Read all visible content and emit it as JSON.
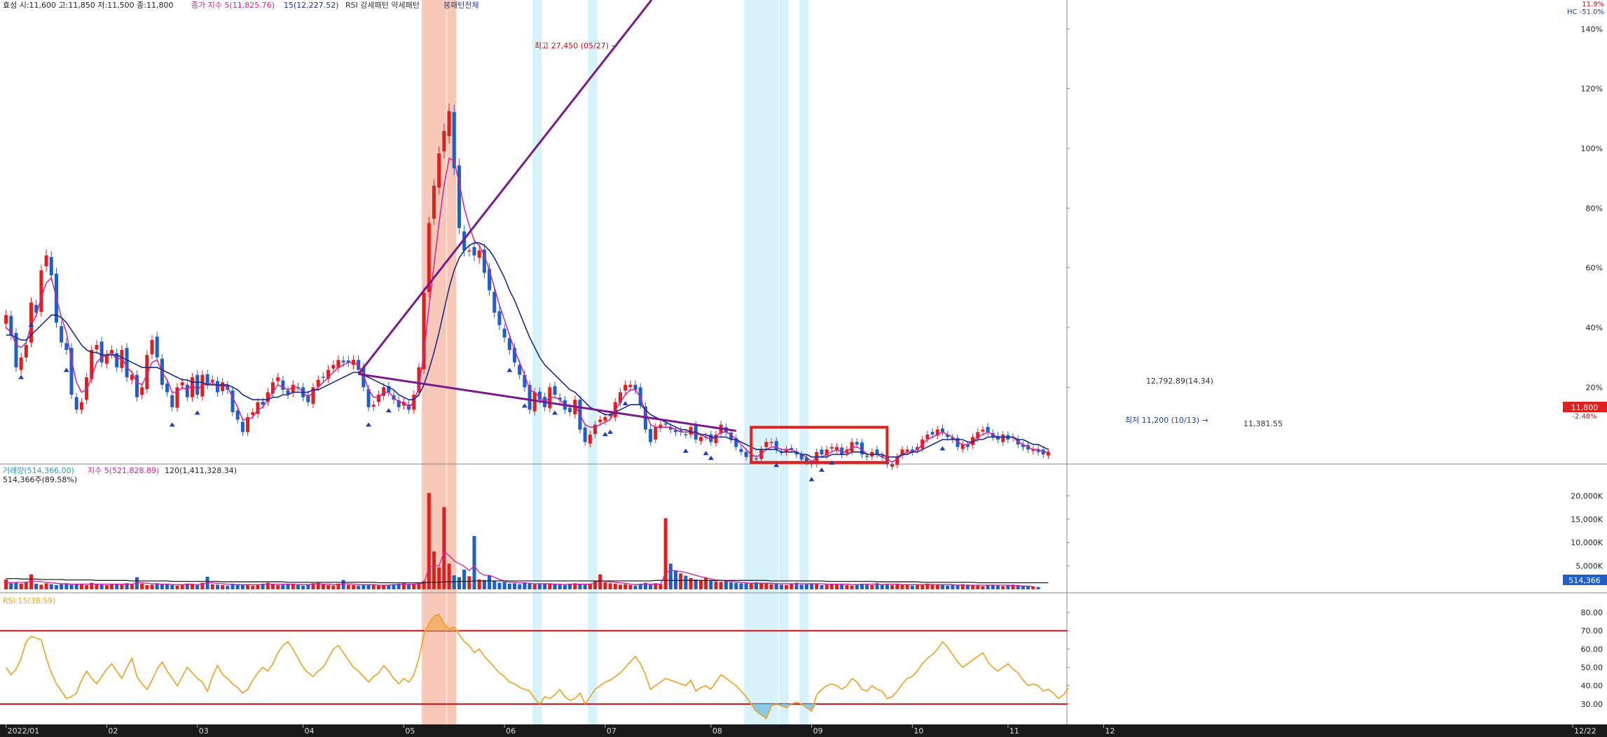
{
  "price_header": {
    "summary": "효성 시:11,600 고:11,850 저:11,500 종:11,800",
    "ma5": "종가 지수 5(11,825.76)",
    "ma15": "15(12,227.52)",
    "rsi_label": "RSI 강세패턴  약세패턴",
    "pattern": "봉패턴전체",
    "corner_top": "11.9%",
    "corner_bottom": "HC -51.0%"
  },
  "annotations": {
    "high": "최고 27,450 (05/27) →",
    "low": "최저 11,200 (10/13) →",
    "box_top": "12,792.89(14.34)",
    "box_bottom": "11,381.55",
    "last_price": "11,800",
    "last_change": "-2.48%"
  },
  "volume_header": {
    "volume": "거래량(514,366.00)",
    "ma5": "지수 5(521,828.89)",
    "ma120": "120(1,411,328.34)",
    "sub": "514,366주(89.58%)",
    "last": "514,366"
  },
  "rsi_header": {
    "label": "RSI 15(38.59)"
  },
  "x_axis": {
    "labels": [
      "2022/01",
      "02",
      "03",
      "04",
      "05",
      "06",
      "07",
      "08",
      "09",
      "10",
      "11",
      "12",
      "12/22"
    ]
  },
  "price_axis": {
    "labels": [
      "140%",
      "120%",
      "100%",
      "80%",
      "60%",
      "40%",
      "20%"
    ]
  },
  "volume_axis": {
    "labels": [
      "20,000K",
      "15,000K",
      "10,000K",
      "5,000K"
    ]
  },
  "rsi_axis": {
    "labels": [
      "80.00",
      "70.00",
      "60.00",
      "50.00",
      "40.00",
      "30.00"
    ]
  },
  "colors": {
    "up": "#e0201e",
    "down": "#1f5fc8",
    "ma5": "#d0209a",
    "ma15": "#1a2a8a",
    "trend": "#7a1a8a",
    "rsi": "#f0a020",
    "rsi_bound": "#d01010",
    "highlight_red": "#f7c8b8",
    "highlight_blue": "#d8f2fb"
  },
  "chart_data": {
    "type": "candlestick",
    "x_range": [
      "2022/01",
      "12/22"
    ],
    "price_close": [
      17300,
      16500,
      15200,
      15600,
      16100,
      17800,
      17400,
      19100,
      19700,
      18900,
      17000,
      16200,
      15900,
      14100,
      13500,
      13800,
      14800,
      15900,
      16100,
      15400,
      15700,
      15900,
      15200,
      15900,
      14800,
      14900,
      14000,
      14400,
      15700,
      16300,
      15600,
      14500,
      14200,
      13600,
      14400,
      14600,
      14000,
      14800,
      14100,
      14900,
      14500,
      14700,
      14200,
      14600,
      14300,
      13400,
      13100,
      12600,
      13200,
      13400,
      13800,
      13700,
      14200,
      14600,
      14800,
      14300,
      14100,
      14500,
      14400,
      14000,
      13800,
      14400,
      14700,
      14800,
      15100,
      15300,
      15500,
      15400,
      15400,
      15500,
      15100,
      14400,
      13600,
      13700,
      14100,
      14400,
      14200,
      13900,
      13600,
      13800,
      13500,
      14100,
      15200,
      18200,
      21000,
      22500,
      23800,
      24700,
      25500,
      23200,
      20800,
      19900,
      19900,
      19700,
      19900,
      19000,
      18300,
      17400,
      16900,
      16400,
      15900,
      15400,
      14900,
      14400,
      13500,
      14200,
      13900,
      13600,
      14400,
      14100,
      13900,
      13500,
      13400,
      13900,
      12700,
      12200,
      12500,
      12900,
      13100,
      13200,
      13300,
      13800,
      14200,
      14500,
      14500,
      14300,
      13700,
      12700,
      12200,
      12800,
      12900,
      12900,
      12700,
      12600,
      12600,
      12500,
      12800,
      12300,
      12400,
      12400,
      12200,
      12500,
      12900,
      12600,
      12300,
      12000,
      11800,
      11600,
      11600,
      11500,
      11900,
      12200,
      12200,
      11900,
      11800,
      11900,
      11900,
      11700,
      11500,
      11400,
      11300,
      11800,
      11700,
      11900,
      12000,
      12000,
      11700,
      11900,
      12200,
      12100,
      11700,
      11600,
      11800,
      11700,
      11600,
      11300,
      11300,
      11600,
      11900,
      11900,
      11800,
      12000,
      12300,
      12500,
      12500,
      12700,
      12600,
      12400,
      12300,
      12000,
      12100,
      12000,
      12400,
      12600,
      12700,
      12600,
      12400,
      12300,
      12500,
      12300,
      12400,
      12100,
      12000,
      11900,
      11900,
      11800,
      11700,
      11800
    ],
    "ma5": [
      16800,
      16600,
      16100,
      16000,
      16200,
      16900,
      17300,
      18000,
      18600,
      18800,
      18000,
      17200,
      16600,
      15500,
      14600,
      14200,
      14300,
      14800,
      15400,
      15600,
      15700,
      15800,
      15500,
      15600,
      15200,
      15000,
      14600,
      14500,
      14900,
      15400,
      15500,
      15000,
      14700,
      14200,
      14200,
      14400,
      14300,
      14500,
      14300,
      14500,
      14500,
      14600,
      14400,
      14500,
      14400,
      14000,
      13600,
      13100,
      13100,
      13200,
      13500,
      13600,
      13900,
      14200,
      14500,
      14400,
      14300,
      14400,
      14400,
      14200,
      14000,
      14200,
      14400,
      14600,
      14800,
      15000,
      15200,
      15300,
      15400,
      15400,
      15300,
      14900,
      14300,
      14000,
      14000,
      14200,
      14200,
      14000,
      13800,
      13800,
      13600,
      13800,
      14400,
      15800,
      17600,
      19300,
      21000,
      22500,
      23600,
      23500,
      22600,
      21600,
      20900,
      20300,
      20100,
      19700,
      19100,
      18400,
      17700,
      17100,
      16500,
      15900,
      15400,
      14900,
      14300,
      14200,
      14000,
      13800,
      14000,
      14000,
      13900,
      13700,
      13600,
      13700,
      13300,
      12900,
      12800,
      12800,
      12900,
      13000,
      13100,
      13500,
      13800,
      14100,
      14300,
      14300,
      14000,
      13400,
      12900,
      12800,
      12800,
      12800,
      12800,
      12700,
      12600,
      12600,
      12600,
      12500,
      12500,
      12400,
      12300,
      12400,
      12600,
      12600,
      12500,
      12300,
      12100,
      11900,
      11700,
      11600,
      11700,
      11900,
      12000,
      12000,
      11900,
      11900,
      11900,
      11800,
      11700,
      11600,
      11400,
      11600,
      11600,
      11700,
      11800,
      11900,
      11800,
      11800,
      12000,
      12000,
      11900,
      11700,
      11700,
      11700,
      11600,
      11500,
      11400,
      11500,
      11700,
      11800,
      11800,
      11900,
      12100,
      12300,
      12400,
      12500,
      12600,
      12500,
      12400,
      12200,
      12100,
      12100,
      12200,
      12400,
      12500,
      12600,
      12500,
      12400,
      12400,
      12400,
      12400,
      12200,
      12100,
      12000,
      11900,
      11900,
      11800,
      11800
    ],
    "ma15": [
      16500,
      16500,
      16400,
      16300,
      16300,
      16500,
      16700,
      16900,
      17100,
      17300,
      17300,
      17200,
      17000,
      16700,
      16400,
      16100,
      15900,
      15800,
      15800,
      15700,
      15700,
      15700,
      15700,
      15600,
      15500,
      15400,
      15300,
      15200,
      15200,
      15200,
      15200,
      15100,
      15000,
      14900,
      14800,
      14700,
      14700,
      14600,
      14600,
      14600,
      14500,
      14500,
      14500,
      14500,
      14500,
      14400,
      14300,
      14100,
      14000,
      13900,
      13900,
      13900,
      13900,
      14000,
      14000,
      14100,
      14100,
      14200,
      14200,
      14200,
      14200,
      14300,
      14300,
      14400,
      14500,
      14600,
      14700,
      14800,
      14900,
      15000,
      15000,
      14900,
      14800,
      14700,
      14600,
      14500,
      14400,
      14300,
      14100,
      14000,
      13900,
      13900,
      14100,
      14500,
      15100,
      15800,
      16600,
      17500,
      18400,
      19100,
      19600,
      19900,
      20100,
      20200,
      20200,
      20100,
      19900,
      19600,
      19200,
      18800,
      18300,
      17900,
      17400,
      16900,
      16400,
      16000,
      15600,
      15300,
      15100,
      14900,
      14700,
      14500,
      14300,
      14200,
      14000,
      13800,
      13600,
      13500,
      13400,
      13300,
      13300,
      13400,
      13500,
      13600,
      13700,
      13700,
      13700,
      13500,
      13300,
      13200,
      13100,
      13000,
      12900,
      12800,
      12700,
      12700,
      12600,
      12600,
      12500,
      12500,
      12400,
      12400,
      12400,
      12400,
      12300,
      12300,
      12200,
      12100,
      12000,
      11900,
      11900,
      11900,
      11900,
      11900,
      11800,
      11800,
      11800,
      11800,
      11700,
      11700,
      11600,
      11600,
      11600,
      11600,
      11700,
      11700,
      11700,
      11700,
      11800,
      11800,
      11800,
      11700,
      11700,
      11700,
      11700,
      11600,
      11600,
      11600,
      11700,
      11700,
      11800,
      11800,
      11900,
      12000,
      12100,
      12200,
      12300,
      12300,
      12300,
      12300,
      12300,
      12200,
      12200,
      12300,
      12300,
      12400,
      12400,
      12400,
      12400,
      12400,
      12400,
      12300,
      12300,
      12200,
      12100,
      12100,
      12000,
      11900
    ],
    "volume_k": [
      2100,
      1300,
      1400,
      1200,
      1600,
      3200,
      1200,
      1000,
      1300,
      1100,
      900,
      1200,
      1300,
      1000,
      1100,
      1200,
      900,
      1400,
      1200,
      1000,
      900,
      1100,
      1200,
      1000,
      1300,
      1100,
      2600,
      1200,
      900,
      1000,
      1300,
      1100,
      1200,
      900,
      800,
      1000,
      1200,
      1100,
      900,
      1400,
      2700,
      1100,
      1000,
      900,
      800,
      1200,
      1100,
      1000,
      900,
      800,
      1000,
      1200,
      1400,
      1100,
      900,
      1000,
      1100,
      1200,
      900,
      800,
      1000,
      1300,
      1400,
      1100,
      900,
      800,
      1200,
      2000,
      1000,
      900,
      800,
      1000,
      900,
      1100,
      800,
      900,
      1000,
      1100,
      1200,
      1300,
      1000,
      1200,
      1300,
      1800,
      20600,
      8100,
      4700,
      17600,
      5500,
      3000,
      2600,
      4200,
      2800,
      11400,
      2100,
      2000,
      3000,
      1800,
      1400,
      1600,
      1200,
      1300,
      1100,
      1400,
      1200,
      1100,
      1300,
      1300,
      1200,
      1100,
      1000,
      900,
      1200,
      1300,
      1100,
      1000,
      1200,
      1800,
      3200,
      1500,
      1300,
      1200,
      1000,
      1100,
      900,
      800,
      1200,
      1400,
      1000,
      1300,
      1100,
      15200,
      5500,
      4000,
      3400,
      2900,
      2400,
      2100,
      2000,
      2500,
      1800,
      1700,
      1600,
      1800,
      1500,
      1400,
      1300,
      1300,
      1200,
      1500,
      1400,
      1200,
      1100,
      1300,
      1000,
      900,
      1200,
      1400,
      1000,
      1100,
      1300,
      1200,
      900,
      1000,
      1200,
      1100,
      1000,
      900,
      800,
      1100,
      1200,
      1000,
      900,
      1300,
      1100,
      1000,
      900,
      1200,
      1000,
      1100,
      800,
      900,
      1000,
      1200,
      1100,
      900,
      1000,
      800,
      900,
      1000,
      1100,
      1000,
      900,
      800,
      700,
      900,
      1000,
      800,
      700,
      900,
      1000,
      900,
      800,
      700,
      600,
      514
    ],
    "volume_ma5_k": [
      1400,
      1400,
      1500,
      1500,
      1500,
      1800,
      1700,
      1600,
      1500,
      1400,
      1300,
      1200,
      1200,
      1100,
      1100,
      1100,
      1100,
      1100,
      1100,
      1100,
      1100,
      1100,
      1100,
      1100,
      1100,
      1100,
      1400,
      1400,
      1300,
      1200,
      1200,
      1100,
      1100,
      1000,
      1000,
      1000,
      1100,
      1100,
      1000,
      1100,
      1400,
      1400,
      1300,
      1200,
      1100,
      1000,
      1000,
      1000,
      1000,
      1000,
      1000,
      1000,
      1100,
      1100,
      1100,
      1100,
      1100,
      1100,
      1000,
      1000,
      1000,
      1100,
      1200,
      1100,
      1100,
      1000,
      1000,
      1200,
      1200,
      1100,
      1000,
      1000,
      1000,
      1000,
      900,
      900,
      900,
      1000,
      1000,
      1100,
      1100,
      1100,
      1200,
      1300,
      4500,
      5200,
      5000,
      8000,
      7200,
      6100,
      5500,
      4900,
      4000,
      5000,
      3600,
      3000,
      3000,
      2600,
      2100,
      1800,
      1500,
      1500,
      1400,
      1400,
      1300,
      1200,
      1200,
      1200,
      1200,
      1100,
      1100,
      1000,
      1100,
      1100,
      1100,
      1100,
      1100,
      1300,
      1800,
      1700,
      1600,
      1500,
      1400,
      1300,
      1100,
      1000,
      1000,
      1100,
      1100,
      1100,
      1100,
      3600,
      4000,
      4000,
      3800,
      3600,
      3300,
      3000,
      2700,
      2500,
      2200,
      2000,
      1900,
      1800,
      1700,
      1600,
      1500,
      1400,
      1300,
      1300,
      1300,
      1300,
      1300,
      1200,
      1200,
      1200,
      1200,
      1200,
      1200,
      1200,
      1200,
      1200,
      1200,
      1100,
      1100,
      1100,
      1100,
      1100,
      1000,
      1000,
      1000,
      1100,
      1100,
      1100,
      1000,
      1100,
      1100,
      1100,
      1000,
      1000,
      1000,
      1000,
      1000,
      1000,
      1000,
      1000,
      1000,
      1000,
      1000,
      900,
      900,
      900,
      900,
      900,
      900,
      900,
      900,
      900,
      900,
      900,
      800,
      800,
      700,
      700,
      600
    ],
    "volume_ma120_k": [
      2300,
      2300,
      2300,
      2200,
      2200,
      2200,
      2200,
      2100,
      2100,
      2100,
      2100,
      2100,
      2000,
      2000,
      2000,
      2000,
      2000,
      2000,
      1900,
      1900,
      1900,
      1900,
      1900,
      1900,
      1900,
      1800,
      1800,
      1800,
      1800,
      1800,
      1800,
      1800,
      1800,
      1700,
      1700,
      1700,
      1700,
      1700,
      1700,
      1700,
      1700,
      1700,
      1700,
      1600,
      1600,
      1600,
      1600,
      1600,
      1600,
      1600,
      1600,
      1600,
      1600,
      1600,
      1600,
      1600,
      1500,
      1500,
      1500,
      1500,
      1500,
      1500,
      1500,
      1500,
      1500,
      1500,
      1500,
      1500,
      1500,
      1500,
      1500,
      1500,
      1500,
      1500,
      1400,
      1400,
      1400,
      1400,
      1400,
      1400,
      1400,
      1400,
      1400,
      1400,
      1500,
      1500,
      1500,
      1600,
      1600,
      1600,
      1700,
      1700,
      1700,
      1800,
      1800,
      1800,
      1800,
      1800,
      1800,
      1800,
      1800,
      1800,
      1800,
      1800,
      1800,
      1800,
      1800,
      1800,
      1800,
      1800,
      1800,
      1800,
      1800,
      1800,
      1800,
      1800,
      1800,
      1800,
      1800,
      1800,
      1800,
      1800,
      1800,
      1800,
      1800,
      1800,
      1800,
      1800,
      1800,
      1900,
      1900,
      1900,
      1900,
      1900,
      1900,
      1900,
      1900,
      1900,
      1900,
      1900,
      1900,
      1900,
      1900,
      1900,
      1900,
      1900,
      1900,
      1900,
      1900,
      1900,
      1900,
      1900,
      1800,
      1800,
      1800,
      1800,
      1800,
      1800,
      1800,
      1800,
      1800,
      1800,
      1800,
      1700,
      1700,
      1700,
      1700,
      1700,
      1700,
      1700,
      1700,
      1700,
      1700,
      1600,
      1600,
      1600,
      1600,
      1600,
      1600,
      1600,
      1600,
      1600,
      1500,
      1500,
      1500,
      1500,
      1500,
      1500,
      1500,
      1500,
      1500,
      1500,
      1500,
      1400,
      1400,
      1400,
      1400,
      1400,
      1400,
      1400,
      1400,
      1400,
      1400,
      1400,
      1400,
      1400,
      1400,
      1400
    ],
    "rsi": [
      50,
      46,
      49,
      55,
      64,
      67,
      66,
      65,
      55,
      47,
      41,
      37,
      33,
      34,
      36,
      43,
      48,
      44,
      41,
      45,
      49,
      52,
      48,
      44,
      50,
      55,
      45,
      41,
      38,
      43,
      49,
      53,
      48,
      44,
      40,
      45,
      50,
      47,
      44,
      42,
      37,
      45,
      51,
      46,
      44,
      41,
      39,
      36,
      38,
      43,
      47,
      50,
      48,
      52,
      58,
      62,
      64,
      60,
      55,
      50,
      47,
      45,
      48,
      50,
      55,
      60,
      62,
      58,
      54,
      50,
      48,
      45,
      42,
      45,
      47,
      51,
      48,
      44,
      41,
      44,
      42,
      46,
      55,
      68,
      74,
      78,
      79,
      74,
      71,
      72,
      68,
      64,
      62,
      58,
      60,
      56,
      53,
      50,
      47,
      45,
      42,
      41,
      39,
      38,
      37,
      33,
      30,
      34,
      33,
      35,
      38,
      34,
      32,
      33,
      36,
      30,
      34,
      38,
      40,
      42,
      43,
      45,
      47,
      50,
      53,
      56,
      52,
      46,
      38,
      40,
      42,
      44,
      43,
      42,
      41,
      40,
      43,
      37,
      39,
      40,
      38,
      42,
      46,
      44,
      42,
      40,
      37,
      34,
      30,
      26,
      24,
      22,
      29,
      30,
      29,
      28,
      30,
      31,
      30,
      28,
      26,
      35,
      38,
      40,
      41,
      40,
      38,
      40,
      44,
      42,
      38,
      37,
      40,
      38,
      37,
      33,
      34,
      37,
      41,
      44,
      45,
      48,
      52,
      55,
      57,
      60,
      64,
      61,
      57,
      53,
      50,
      52,
      54,
      56,
      58,
      53,
      50,
      48,
      50,
      52,
      49,
      47,
      43,
      40,
      41,
      40,
      37,
      38,
      36,
      33,
      35,
      38.59
    ],
    "annotations": {
      "high": {
        "label": "최고 27,450 (05/27)",
        "value": 27450
      },
      "low": {
        "label": "최저 11,200 (10/13)",
        "value": 11200
      },
      "box": {
        "top": 12792.89,
        "bottom": 11381.55
      }
    },
    "last": {
      "price": 11800,
      "change_pct": -2.48,
      "volume": 514366
    }
  }
}
